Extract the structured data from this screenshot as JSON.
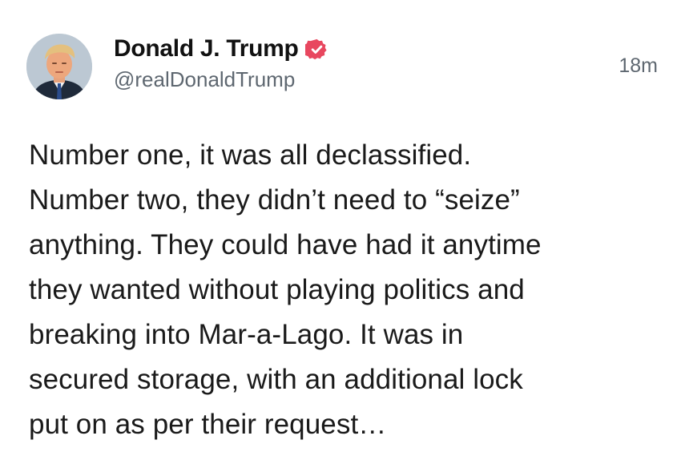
{
  "post": {
    "author": {
      "display_name": "Donald J. Trump",
      "handle": "@realDonaldTrump",
      "verified": true,
      "avatar_icon": "profile-photo"
    },
    "timestamp": "18m",
    "body_lines": [
      "Number one, it was all declassified.",
      "Number two, they didn’t need to “seize”",
      "anything. They could have had it anytime",
      "they wanted without playing politics and",
      "breaking into Mar-a-Lago. It was in",
      "secured storage, with an additional lock",
      "put on as per their request…"
    ]
  },
  "colors": {
    "verified_badge": "#e8475f",
    "secondary_text": "#5e6770",
    "primary_text": "#111111"
  }
}
